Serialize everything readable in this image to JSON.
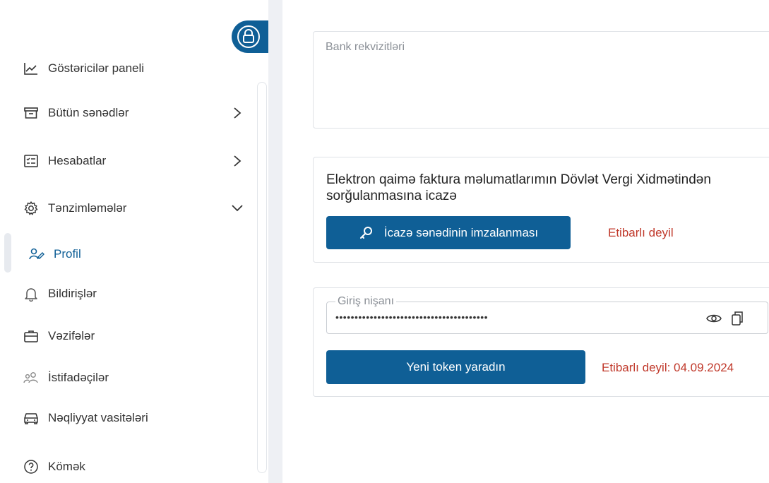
{
  "sidebar": {
    "items": [
      {
        "label": "Göstəricilər paneli",
        "icon": "chart-line-icon"
      },
      {
        "label": "Bütün sənədlər",
        "icon": "archive-box-icon"
      },
      {
        "label": "Hesabatlar",
        "icon": "checklist-icon"
      },
      {
        "label": "Tənzimləmələr",
        "icon": "gear-icon"
      },
      {
        "label": "Profil",
        "icon": "users-icon"
      },
      {
        "label": "Bildirişlər",
        "icon": "bell-icon"
      },
      {
        "label": "Vəzifələr",
        "icon": "briefcase-icon"
      },
      {
        "label": "İstifadəçilər",
        "icon": "people-icon"
      },
      {
        "label": "Nəqliyyat vasitələri",
        "icon": "car-icon"
      },
      {
        "label": "Kömək",
        "icon": "help-circle-icon"
      }
    ]
  },
  "bank": {
    "label": "Bank rekvizitləri"
  },
  "permission": {
    "title": "Elektron qaimə faktura məlumatlarımın Dövlət Vergi Xidmətindən sorğulanmasına icazə",
    "sign_button": "İcazə sənədinin imzalanması",
    "status": "Etibarlı deyil"
  },
  "token": {
    "legend": "Giriş nişanı",
    "value": "••••••••••••••••••••••••••••••••••••••••",
    "generate_button": "Yeni token yaradın",
    "status": "Etibarlı deyil: 04.09.2024"
  },
  "colors": {
    "primary": "#0f5f96",
    "danger": "#c0392b"
  }
}
